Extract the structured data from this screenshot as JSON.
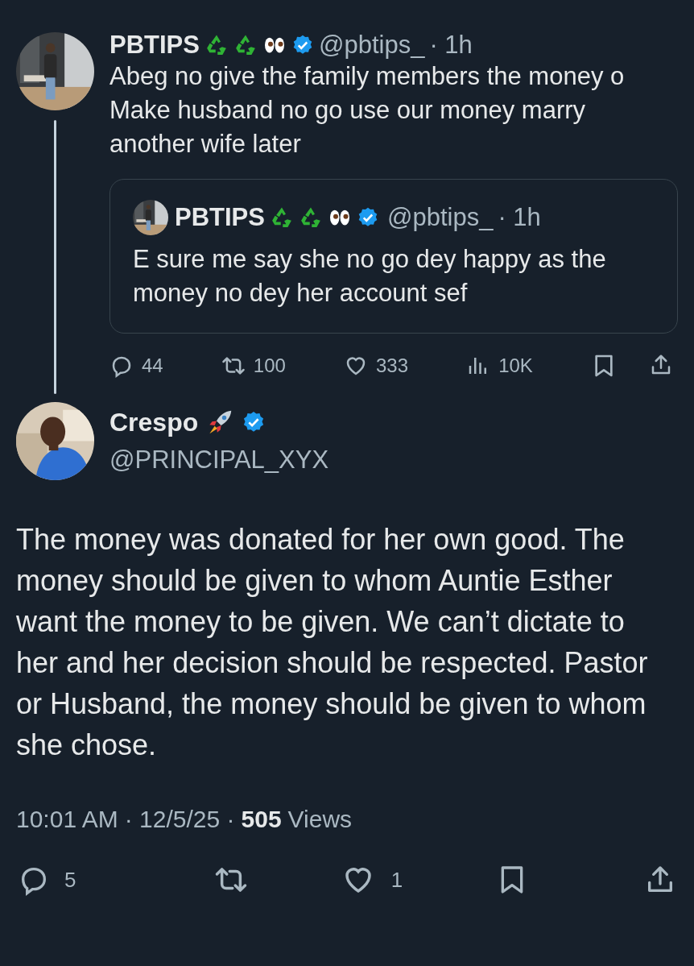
{
  "parent_tweet": {
    "name": "PBTIPS",
    "verified": true,
    "handle": "@pbtips_",
    "time": "· 1h",
    "text": "Abeg no give the family members the money o Make husband no go use our money marry another wife later",
    "quote": {
      "name": "PBTIPS",
      "verified": true,
      "handle": "@pbtips_",
      "time": "· 1h",
      "text": "E sure me say she no go dey happy as the money no dey her account sef"
    },
    "stats": {
      "replies": "44",
      "reposts": "100",
      "likes": "333",
      "views": "10K"
    }
  },
  "main_tweet": {
    "name": "Crespo",
    "verified": true,
    "handle": "@PRINCIPAL_XYX",
    "text": "The money was donated for her own good. The money should be given to whom Auntie Esther want the money to be given. We can’t dictate to her and her decision should be respected. Pastor or Husband, the money should be given to whom she chose.",
    "time": "10:01 AM",
    "date": "· 12/5/25 ·",
    "views_count": "505",
    "views_label": "Views",
    "stats": {
      "replies": "5",
      "likes": "1"
    }
  }
}
